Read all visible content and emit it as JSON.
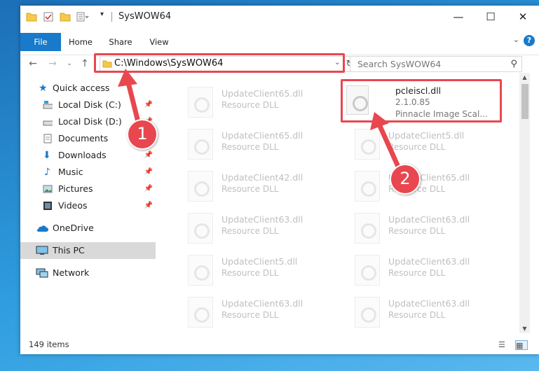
{
  "window": {
    "title": "SysWOW64",
    "controls": {
      "minimize": "—",
      "maximize": "☐",
      "close": "✕"
    }
  },
  "ribbon": {
    "tabs": [
      "File",
      "Home",
      "Share",
      "View"
    ],
    "help": "?"
  },
  "nav": {
    "address": "C:\\Windows\\SysWOW64",
    "search_placeholder": "Search SysWOW64"
  },
  "sidebar": {
    "items": [
      {
        "label": "Quick access"
      },
      {
        "label": "Local Disk (C:)"
      },
      {
        "label": "Local Disk (D:)"
      },
      {
        "label": "Documents"
      },
      {
        "label": "Downloads"
      },
      {
        "label": "Music"
      },
      {
        "label": "Pictures"
      },
      {
        "label": "Videos"
      },
      {
        "label": "OneDrive"
      },
      {
        "label": "This PC"
      },
      {
        "label": "Network"
      }
    ]
  },
  "files": {
    "highlighted": {
      "name": "pcleiscl.dll",
      "version": "2.1.0.85",
      "desc": "Pinnacle Image Scal..."
    },
    "left_column": [
      {
        "name": "UpdateClient65.dll",
        "desc": "Resource DLL"
      },
      {
        "name": "UpdateClient65.dll",
        "desc": "Resource DLL"
      },
      {
        "name": "UpdateClient42.dll",
        "desc": "Resource DLL"
      },
      {
        "name": "UpdateClient63.dll",
        "desc": "Resource DLL"
      },
      {
        "name": "UpdateClient5.dll",
        "desc": "Resource DLL"
      },
      {
        "name": "UpdateClient63.dll",
        "desc": "Resource DLL"
      }
    ],
    "right_column": [
      {
        "name": "UpdateClient5.dll",
        "desc": "Resource DLL"
      },
      {
        "name": "UpdateClient65.dll",
        "desc": "Resource DLL"
      },
      {
        "name": "UpdateClient63.dll",
        "desc": "Resource DLL"
      },
      {
        "name": "UpdateClient63.dll",
        "desc": "Resource DLL"
      },
      {
        "name": "UpdateClient63.dll",
        "desc": "Resource DLL"
      }
    ]
  },
  "status": {
    "count": "149 items"
  },
  "annotations": {
    "badge1": "1",
    "badge2": "2",
    "color": "#e8474f"
  }
}
